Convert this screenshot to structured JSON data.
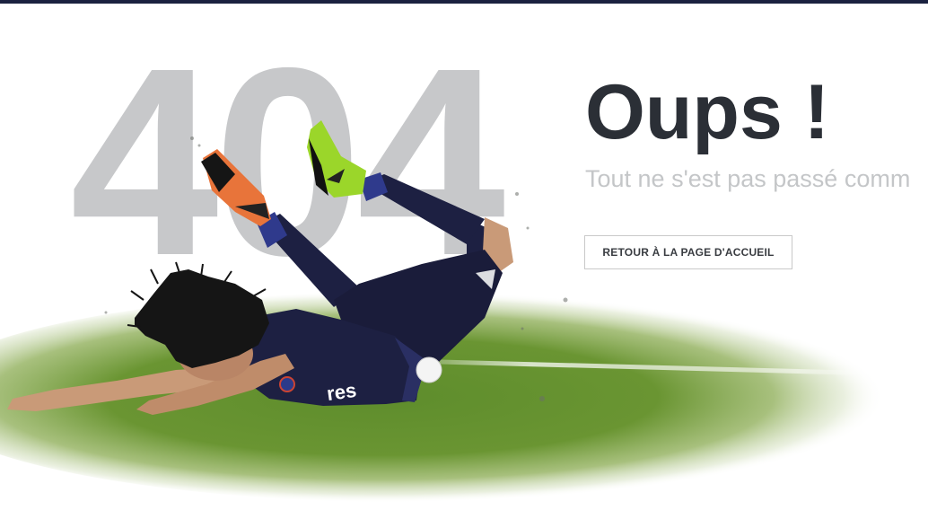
{
  "error_page": {
    "code": "404",
    "title": "Oups !",
    "subtitle": "Tout ne s'est pas passé comm",
    "home_button_label": "RETOUR À LA PAGE D'ACCUEIL"
  },
  "illustration": {
    "jersey_text": "res"
  },
  "colors": {
    "top_bar": "#1b2140",
    "code": "#c7c8ca",
    "title": "#2b2f36",
    "subtitle": "#c4c6c8",
    "pitch_green": "#5d8f2a",
    "kit_navy": "#1d2042"
  }
}
